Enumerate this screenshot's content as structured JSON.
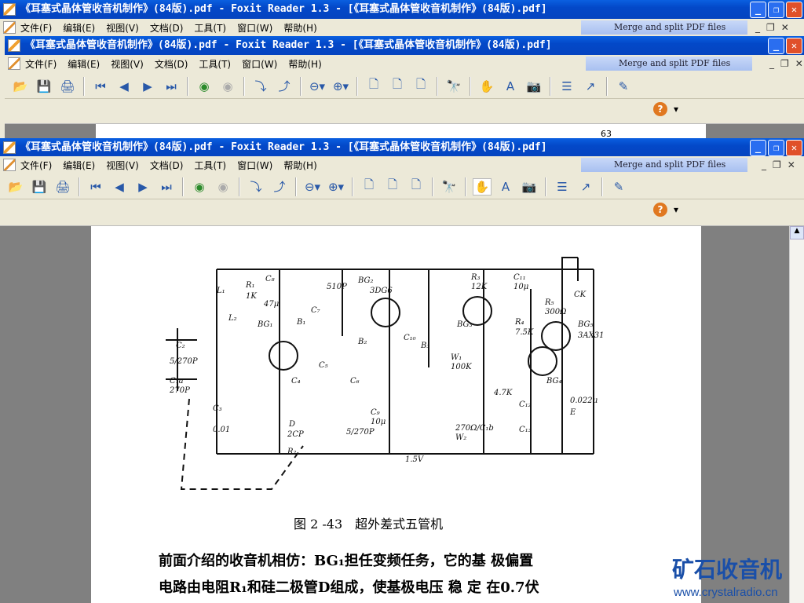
{
  "window": {
    "title": "《耳塞式晶体管收音机制作》(84版).pdf - Foxit Reader 1.3 - [《耳塞式晶体管收音机制作》(84版).pdf]",
    "title_short": "《耳塞式晶体管收音机制作》(84版).pdf - Foxit Reader 1.3 - [《耳塞式晶体管收音机制作》(84版).pdf]"
  },
  "menu": [
    "文件(F)",
    "编辑(E)",
    "视图(V)",
    "文档(D)",
    "工具(T)",
    "窗口(W)",
    "帮助(H)"
  ],
  "merge_banner": "Merge and split PDF files",
  "page_number_peek": "63",
  "document": {
    "figure_caption": "图 2 -43　超外差式五管机",
    "paragraph": [
      "前面介绍的收音机相仿：BG₁担任变频任务，它的基 极偏置",
      "电路由电阻R₁和硅二极管D组成，使基极电压 稳 定 在0.7伏"
    ],
    "schematic_labels": [
      "C₈",
      "R₁",
      "1K",
      "47μ",
      "BG₁",
      "B₁",
      "C₇",
      "510P",
      "BG₂",
      "3DG6",
      "B₂",
      "C₁₀",
      "B₃",
      "R₃",
      "12K",
      "C₁₁",
      "10μ",
      "CK",
      "R₅",
      "300Ω",
      "BG₅",
      "3AX31",
      "R₄",
      "7.5K",
      "BG₃",
      "W₁",
      "100K",
      "BG₄",
      "L₁",
      "L₂",
      "C₂",
      "5/270P",
      "C₁a",
      "270P",
      "C₃",
      "0.01",
      "C₄",
      "C₅",
      "C₆",
      "5/270P",
      "C₉",
      "10μ",
      "D",
      "2CP",
      "R₂",
      "270Ω/C₁b",
      "W₂",
      "4.7K",
      "C₁₂",
      "C₁₃",
      "0.022μ",
      "E",
      "1.5V"
    ]
  },
  "watermark": {
    "logo_text": "矿石收音机",
    "url": "www.crystalradio.cn"
  }
}
